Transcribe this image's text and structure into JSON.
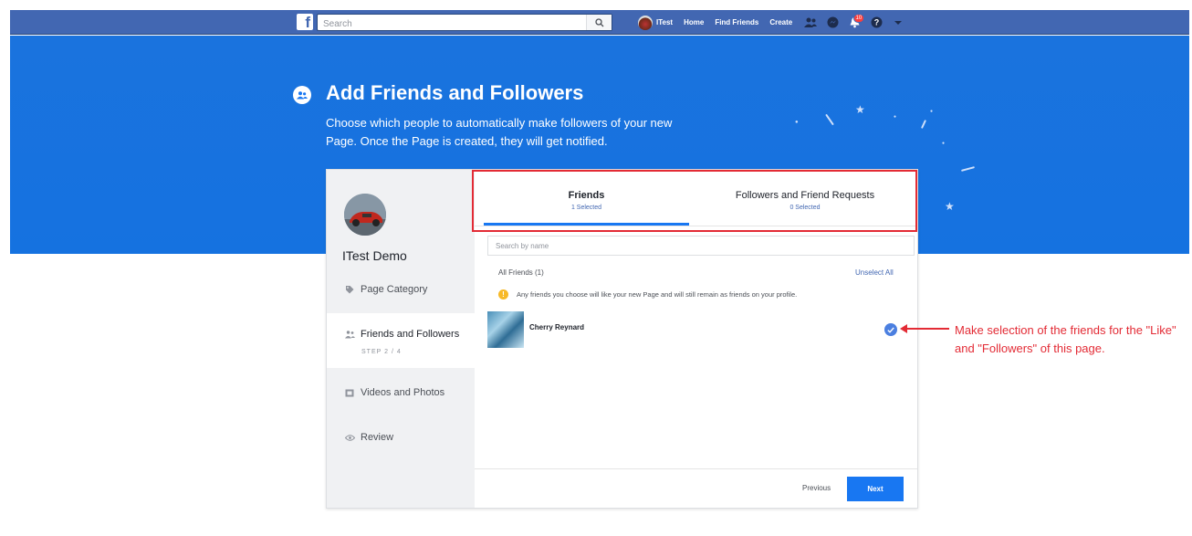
{
  "nav": {
    "logo": "f",
    "search_placeholder": "Search",
    "user_name": "ITest",
    "links": [
      "Home",
      "Find Friends",
      "Create"
    ],
    "notification_count": "10"
  },
  "header": {
    "title": "Add Friends and Followers",
    "description": "Choose which people to automatically make followers of your new Page. Once the Page is created, they will get notified."
  },
  "sidebar": {
    "page_name": "ITest Demo",
    "steps": [
      {
        "label": "Page Category"
      },
      {
        "label": "Friends and Followers",
        "sub": "STEP 2 / 4"
      },
      {
        "label": "Videos and Photos"
      },
      {
        "label": "Review"
      }
    ]
  },
  "tabs": [
    {
      "label": "Friends",
      "count": "1 Selected"
    },
    {
      "label": "Followers and Friend Requests",
      "count": "0 Selected"
    }
  ],
  "content": {
    "search_placeholder": "Search by name",
    "all_friends_label": "All Friends (1)",
    "unselect_all": "Unselect All",
    "notice": "Any friends you choose will like your new Page and will still remain as friends on your profile.",
    "friends": [
      {
        "name": "Cherry Reynard",
        "selected": true
      }
    ],
    "previous": "Previous",
    "next": "Next"
  },
  "annotation": {
    "text": "Make selection of the friends for the \"Like\" and \"Followers\" of this page.",
    "color": "#e32b35"
  },
  "colors": {
    "nav_blue": "#4267b2",
    "banner_blue": "#1877f2",
    "accent": "#1877f2"
  }
}
